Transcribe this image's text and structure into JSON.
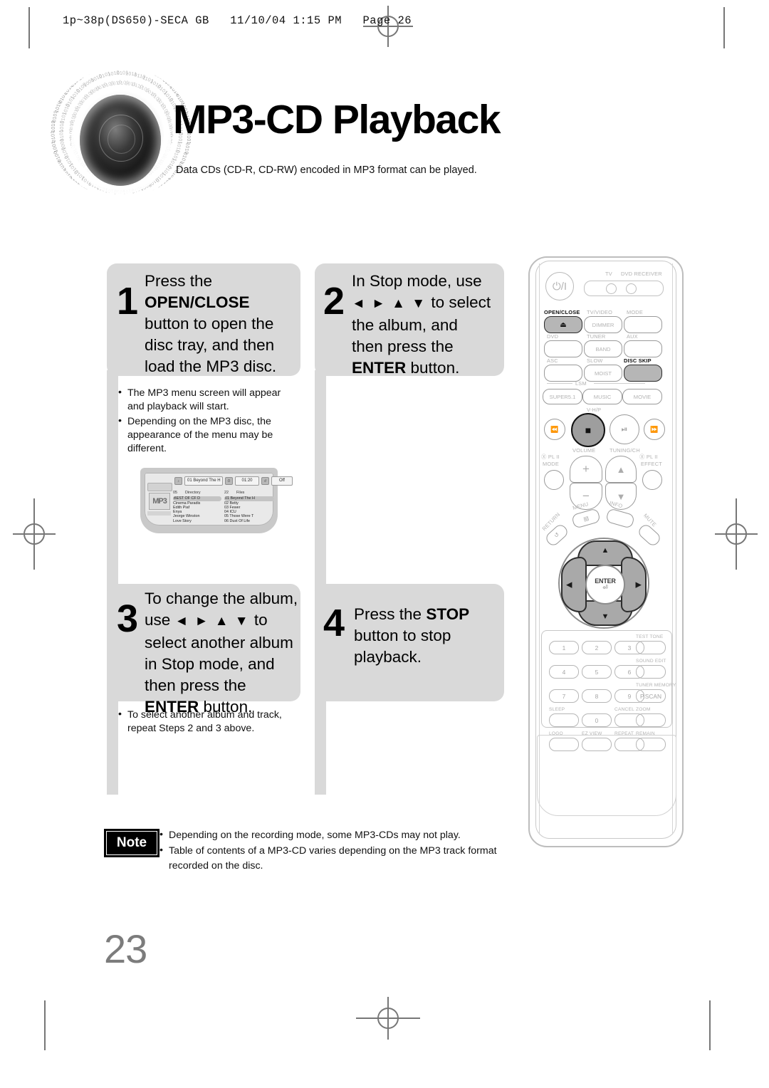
{
  "print_slug": "1p~38p(DS650)-SECA GB   11/10/04 1:15 PM   Page 26",
  "title": "MP3-CD Playback",
  "subtitle": "Data CDs (CD-R, CD-RW) encoded in MP3 format can be played.",
  "page_number": "23",
  "steps": [
    {
      "number": "1",
      "line1": "Press the",
      "bold1": "OPEN/CLOSE",
      "line2": "button to open the",
      "line3": "disc tray, and then",
      "line4": "load the MP3 disc.",
      "bullets": [
        "The MP3 menu screen will appear and playback will start.",
        "Depending on the MP3 disc, the appearance of the menu may be different."
      ]
    },
    {
      "number": "2",
      "line1": "In Stop mode, use",
      "arrows": "◄ ► ▲ ▼",
      "line2": "to select",
      "line3": "the album, and",
      "line4": "then press the",
      "bold1": "ENTER",
      "line5": "button.",
      "bullets": []
    },
    {
      "number": "3",
      "line1": "To change the album,",
      "line2": "use",
      "arrows": "◄ ► ▲ ▼",
      "line3": "to",
      "line4": "select another album",
      "line5": "in Stop mode, and",
      "line6": "then press the",
      "bold1": "ENTER",
      "line7": "button.",
      "bullets": [
        "To select another album and track, repeat Steps 2 and 3 above."
      ]
    },
    {
      "number": "4",
      "line1": "Press the",
      "bold1": "STOP",
      "line2": "button to stop",
      "line3": "playback.",
      "bullets": []
    }
  ],
  "tv_screen": {
    "status": {
      "track": "01 Beyond The H",
      "time": "01:20",
      "repeat": "Off"
    },
    "directory": {
      "count": "05",
      "label": "Directory",
      "rows": [
        "BEST OF CF D",
        "Cinema Paradis",
        "Edith Piaf",
        "Enya",
        "Jeorge Winston",
        "Love Story"
      ],
      "selected_index": 0
    },
    "files": {
      "count": "22",
      "label": "Files",
      "rows": [
        "01 Beyond The H",
        "02 Betty",
        "03 Fewer",
        "04 ICU",
        "05 Those Were T",
        "06 Dust Of Life"
      ],
      "selected_index": 0
    },
    "mp3_logo": "MP3"
  },
  "note": {
    "badge": "Note",
    "bullets": [
      "Depending on the recording mode, some MP3-CDs may not play.",
      "Table of contents of a MP3-CD varies depending on the MP3 track format recorded on the disc."
    ]
  },
  "remote": {
    "power_glyph": "⏻/I",
    "mode_labels": {
      "tv": "TV",
      "dvd": "DVD RECEIVER"
    },
    "buttons": [
      {
        "top": "OPEN/CLOSE",
        "bottom": "",
        "highlight": true
      },
      {
        "top": "TV/VIDEO",
        "bottom": "DIMMER",
        "highlight": false
      },
      {
        "top": "MODE",
        "bottom": "",
        "highlight": false
      },
      {
        "top": "DVD",
        "bottom": "",
        "highlight": false
      },
      {
        "top": "TUNER",
        "bottom": "BAND",
        "highlight": false
      },
      {
        "top": "AUX",
        "bottom": "",
        "highlight": false
      },
      {
        "top": "ASC",
        "bottom": "",
        "highlight": false
      },
      {
        "top": "SLOW",
        "bottom": "MOIST",
        "highlight": false
      },
      {
        "top": "DISC SKIP",
        "bottom": "",
        "highlight": true
      }
    ],
    "lsm_label": "LSM",
    "lsm_buttons": [
      "SUPER5.1",
      "MUSIC",
      "MOVIE"
    ],
    "vhp_label": "V-H/P",
    "transport": [
      "⏮",
      "■",
      "▶‖",
      "⏭"
    ],
    "volume_label": "VOLUME",
    "tuning_label": "TUNING/CH",
    "plii_mode": "Ⓧ PL II",
    "plii_mode2": "MODE",
    "plii_effect": "Ⓧ PL II",
    "plii_effect2": "EFFECT",
    "menu_label": "MENU",
    "info_label": "INFO",
    "return_label": "RETURN",
    "mute_label": "MUTE",
    "enter_label": "ENTER",
    "nav_glyphs": {
      "up": "▲",
      "down": "▼",
      "left": "◀",
      "right": "▶"
    },
    "keypad": [
      {
        "key": "1",
        "label": ""
      },
      {
        "key": "2",
        "label": ""
      },
      {
        "key": "3",
        "label": ""
      },
      {
        "key": "",
        "label": "TEST TONE"
      },
      {
        "key": "4",
        "label": ""
      },
      {
        "key": "5",
        "label": ""
      },
      {
        "key": "6",
        "label": ""
      },
      {
        "key": "",
        "label": "SOUND EDIT"
      },
      {
        "key": "7",
        "label": ""
      },
      {
        "key": "8",
        "label": ""
      },
      {
        "key": "9",
        "label": ""
      },
      {
        "key": "P.SCAN",
        "label": "TUNER MEMORY"
      },
      {
        "key": "",
        "label": "SLEEP"
      },
      {
        "key": "0",
        "label": ""
      },
      {
        "key": "",
        "label": "CANCEL"
      },
      {
        "key": "",
        "label": "ZOOM"
      },
      {
        "key": "",
        "label": "LOGO"
      },
      {
        "key": "",
        "label": "EZ VIEW"
      },
      {
        "key": "",
        "label": "REPEAT"
      },
      {
        "key": "",
        "label": "REMAIN"
      }
    ]
  },
  "colors": {
    "step_bg": "#d9d9d9",
    "page_num": "#7c7c7c",
    "note_bg": "#000000"
  }
}
